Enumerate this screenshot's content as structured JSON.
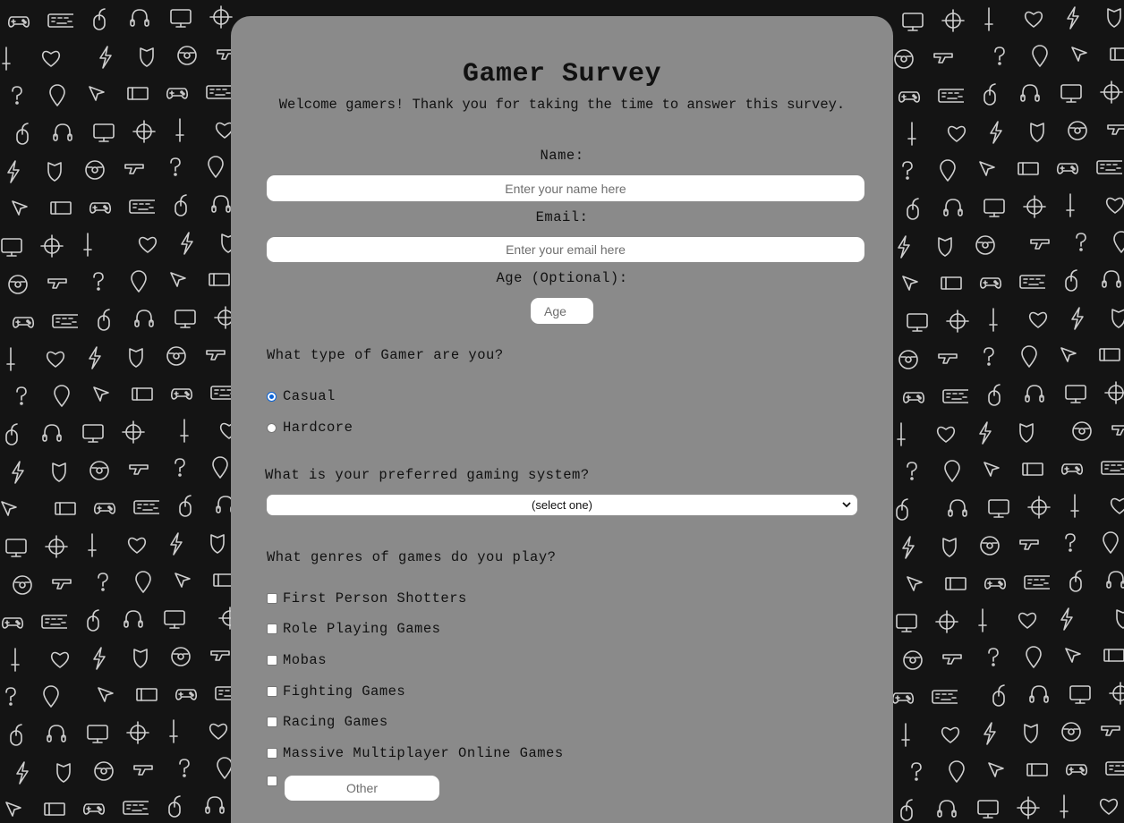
{
  "survey": {
    "title": "Gamer Survey",
    "welcome": "Welcome gamers! Thank you for taking the time to answer this survey.",
    "name_label": "Name:",
    "name_placeholder": "Enter your name here",
    "email_label": "Email:",
    "email_placeholder": "Enter your email here",
    "age_label": "Age (Optional):",
    "age_placeholder": "Age",
    "gamer_type_question": "What type of Gamer are you?",
    "gamer_types": [
      {
        "label": "Casual",
        "selected": true
      },
      {
        "label": "Hardcore",
        "selected": false
      }
    ],
    "system_question": "What is your preferred gaming system?",
    "system_selected": "(select one)",
    "genres_question": "What genres of games do you play?",
    "genres": [
      {
        "label": "First Person Shotters",
        "checked": false
      },
      {
        "label": "Role Playing Games",
        "checked": false
      },
      {
        "label": "Mobas",
        "checked": false
      },
      {
        "label": "Fighting Games",
        "checked": false
      },
      {
        "label": "Racing Games",
        "checked": false
      },
      {
        "label": "Massive Multiplayer Online Games",
        "checked": false
      }
    ],
    "other_placeholder": "Other"
  },
  "colors": {
    "background": "#141414",
    "card": "#8a8a8a",
    "radio_accent": "#0a63d6",
    "doodle": "#cfcfcf"
  },
  "background_icons": [
    "gamepad-icon",
    "keyboard-icon",
    "mouse-icon",
    "headset-icon",
    "monitor-icon",
    "crosshair-icon",
    "sword-icon",
    "heart-icon",
    "lightning-icon",
    "shield-icon",
    "steering-wheel-icon",
    "blaster-icon",
    "question-mark-icon",
    "map-pin-icon",
    "cursor-icon",
    "ticket-icon"
  ]
}
